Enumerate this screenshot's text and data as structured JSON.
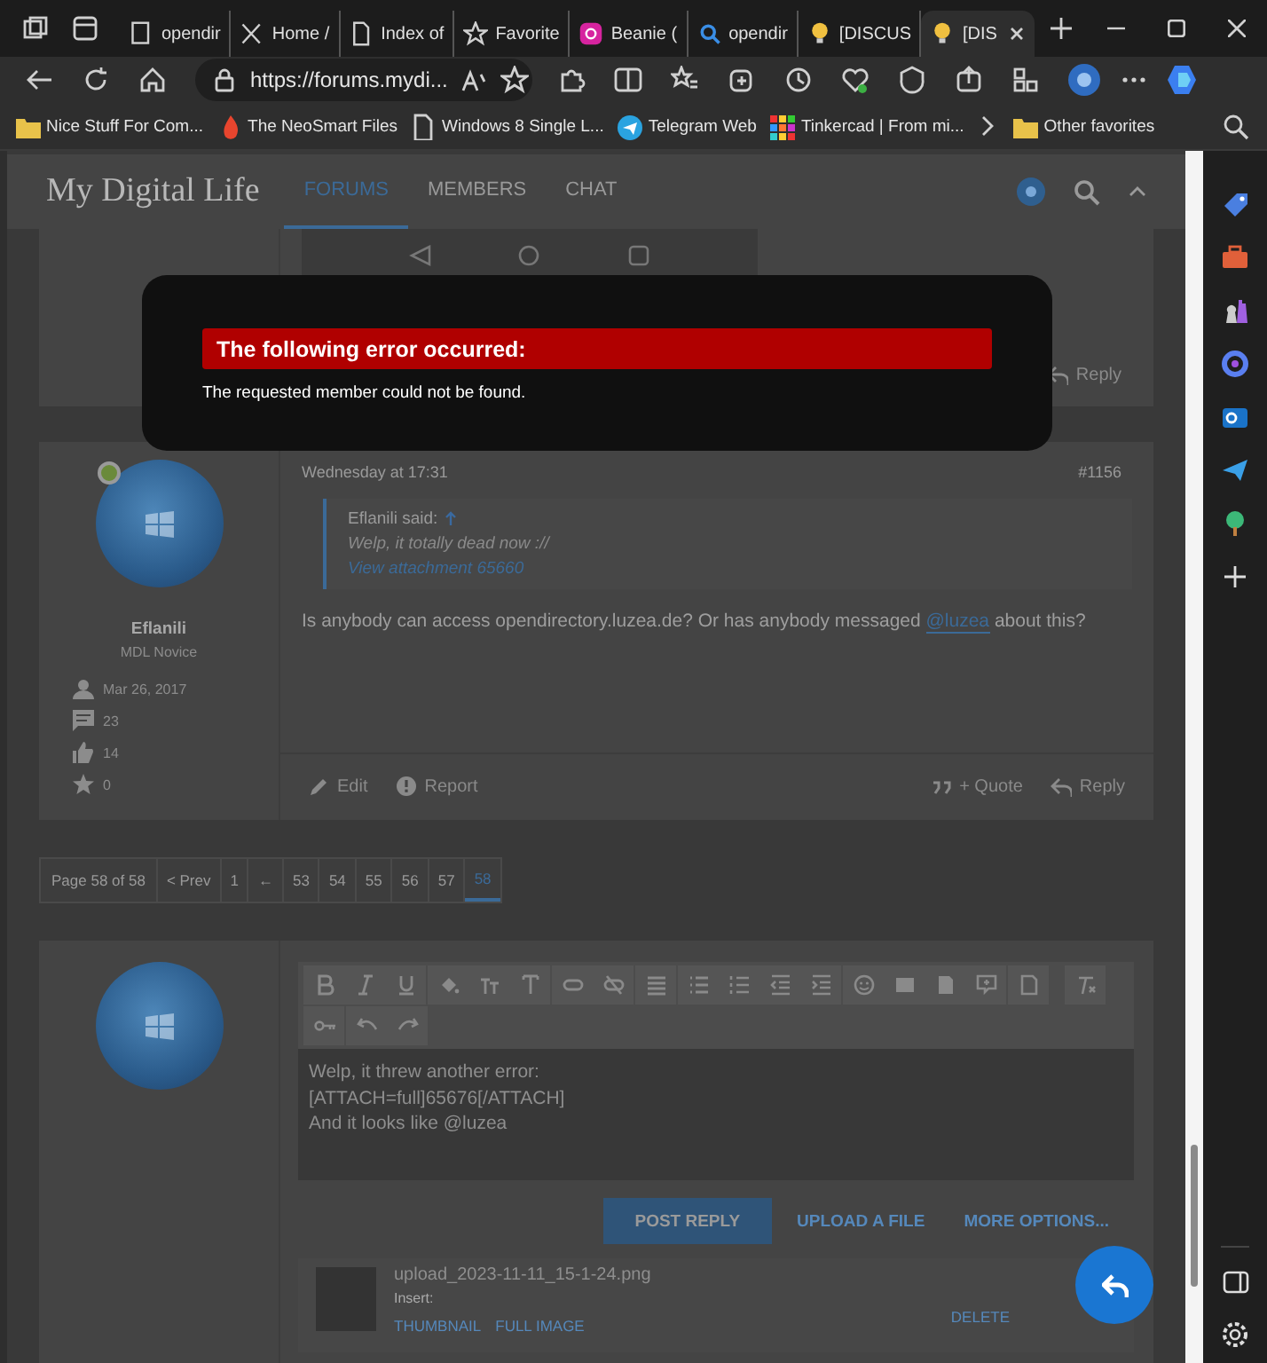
{
  "browser": {
    "tabs": [
      {
        "label": "opendir",
        "selected": false
      },
      {
        "label": "Home /",
        "selected": false
      },
      {
        "label": "Index of",
        "selected": false
      },
      {
        "label": "Favorite",
        "selected": false
      },
      {
        "label": "Beanie (",
        "selected": false
      },
      {
        "label": "opendir",
        "selected": false
      },
      {
        "label": "[DISCUS",
        "selected": false
      },
      {
        "label": "[DIS",
        "selected": true
      }
    ],
    "address": "https://forums.mydi...",
    "bookmarks": [
      "Nice Stuff For Com...",
      "The NeoSmart Files",
      "Windows 8 Single L...",
      "Telegram Web",
      "Tinkercad | From mi..."
    ],
    "other_favorites": "Other favorites"
  },
  "site": {
    "logo": "My Digital Life",
    "nav": [
      {
        "label": "FORUMS",
        "selected": true
      },
      {
        "label": "MEMBERS",
        "selected": false
      },
      {
        "label": "CHAT",
        "selected": false
      }
    ]
  },
  "error_dialog": {
    "title": "The following error occurred:",
    "message": "The requested member could not be found."
  },
  "previous_post": {
    "reply": "Reply"
  },
  "post": {
    "author": "Eflanili",
    "user_title": "MDL Novice",
    "online": true,
    "stats": [
      {
        "kind": "joined",
        "value": "Mar 26, 2017"
      },
      {
        "kind": "messages",
        "value": "23"
      },
      {
        "kind": "reactions",
        "value": "14"
      },
      {
        "kind": "points",
        "value": "0"
      }
    ],
    "date": "Wednesday at 17:31",
    "number": "#1156",
    "quote": {
      "author": "Eflanili said:",
      "text": "Welp, it totally dead now ://",
      "link": "View attachment 65660"
    },
    "body": "Is anybody can access opendirectory.luzea.de? Or has anybody messaged",
    "mention": "@luzea",
    "body_end": "about this?",
    "actions_left": [
      {
        "kind": "edit",
        "label": "Edit"
      },
      {
        "kind": "report",
        "label": "Report"
      }
    ],
    "actions_right": [
      {
        "kind": "quote",
        "label": "+ Quote"
      },
      {
        "kind": "reply",
        "label": "Reply"
      }
    ]
  },
  "pagination": {
    "label": "Page 58 of 58",
    "pages": [
      {
        "label": "< Prev",
        "selected": false
      },
      {
        "label": "1",
        "selected": false
      },
      {
        "label": "←",
        "selected": false
      },
      {
        "label": "53",
        "selected": false
      },
      {
        "label": "54",
        "selected": false
      },
      {
        "label": "55",
        "selected": false
      },
      {
        "label": "56",
        "selected": false
      },
      {
        "label": "57",
        "selected": false
      },
      {
        "label": "58",
        "selected": true
      }
    ]
  },
  "reply_form": {
    "lines": [
      "Welp, it threw another error:",
      "[ATTACH=full]65676[/ATTACH]",
      "And it looks like @luzea"
    ],
    "buttons": [
      {
        "kind": "primary",
        "label": "POST REPLY"
      },
      {
        "kind": "link",
        "label": "UPLOAD A FILE"
      },
      {
        "kind": "link",
        "label": "MORE OPTIONS..."
      }
    ],
    "attachment": {
      "filename": "upload_2023-11-11_15-1-24.png",
      "insert_label": "Insert:",
      "links": [
        "THUMBNAIL",
        "FULL IMAGE"
      ],
      "delete": "DELETE"
    }
  }
}
